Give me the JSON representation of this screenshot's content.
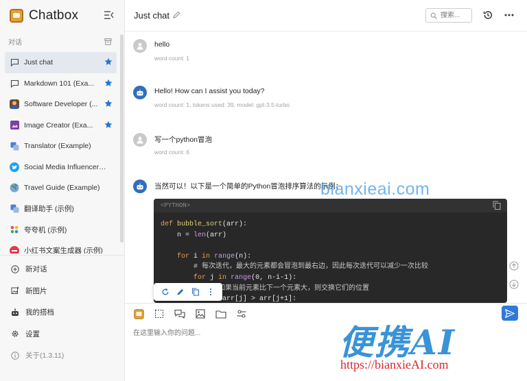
{
  "sidebar": {
    "app_name": "Chatbox",
    "section_label": "对话",
    "conversations": [
      {
        "label": "Just chat",
        "icon": "chat-bubble-icon",
        "starred": true,
        "active": true
      },
      {
        "label": "Markdown 101 (Exa...",
        "icon": "chat-bubble-icon",
        "starred": true
      },
      {
        "label": "Software Developer (...",
        "icon": "developer-avatar-icon",
        "starred": true
      },
      {
        "label": "Image Creator (Exa...",
        "icon": "image-creator-icon",
        "starred": true
      },
      {
        "label": "Translator (Example)",
        "icon": "translator-icon",
        "starred": false
      },
      {
        "label": "Social Media Influencer (E...",
        "icon": "twitter-icon",
        "starred": false
      },
      {
        "label": "Travel Guide (Example)",
        "icon": "globe-icon",
        "starred": false
      },
      {
        "label": "翻译助手 (示例)",
        "icon": "translator-icon",
        "starred": false
      },
      {
        "label": "夸夸机 (示例)",
        "icon": "praise-icon",
        "starred": false
      },
      {
        "label": "小红书文案生成器 (示例)",
        "icon": "xiaohongshu-icon",
        "starred": false
      }
    ],
    "bottom": {
      "new_chat": "新对话",
      "new_image": "新图片",
      "my_partners": "我的搭档",
      "settings": "设置",
      "about": "关于(1.3.11)"
    }
  },
  "header": {
    "title": "Just chat",
    "search_placeholder": "搜索..."
  },
  "messages": [
    {
      "role": "user",
      "text": "hello",
      "meta": "word count: 1"
    },
    {
      "role": "assistant",
      "text": "Hello! How can I assist you today?",
      "meta": "word count: 1, tokens used: 39, model: gpt-3.5-turbo"
    },
    {
      "role": "user",
      "text": "写一个python冒泡",
      "meta": "word count: 6"
    },
    {
      "role": "assistant",
      "text": "当然可以！以下是一个简单的Python冒泡排序算法的示例：",
      "meta": ""
    }
  ],
  "code": {
    "language": "<PYTHON>",
    "line1_kw": "def",
    "line1_fn": "bubble_sort",
    "line1_rest": "(arr):",
    "line2_a": "    n = ",
    "line2_bi": "len",
    "line2_b": "(arr)",
    "line4_kw1": "for",
    "line4_a": " i ",
    "line4_kw2": "in",
    "line4_bi": " range",
    "line4_b": "(n):",
    "line5_cm": "        # 每次迭代，最大的元素都会冒泡到最右边，因此每次迭代可以减少一次比较",
    "line6_kw1": "for",
    "line6_a": " j ",
    "line6_kw2": "in",
    "line6_bi": " range",
    "line6_b": "(0, n-i-1):",
    "line7_cm": "            # 如果当前元素比下一个元素大，则交换它们的位置",
    "line8_kw": "if",
    "line8_a": " arr[j] > arr[j+1]:"
  },
  "composer": {
    "placeholder": "在这里输入你的问题..."
  },
  "watermark": {
    "overlay": "bianxieai.com",
    "brand": "便携AI",
    "url": "https://bianxieAI.com"
  },
  "colors": {
    "accent": "#2f7ad8",
    "star": "#1f78d1",
    "code_bg": "#282828",
    "brand_red": "#d8262d"
  }
}
